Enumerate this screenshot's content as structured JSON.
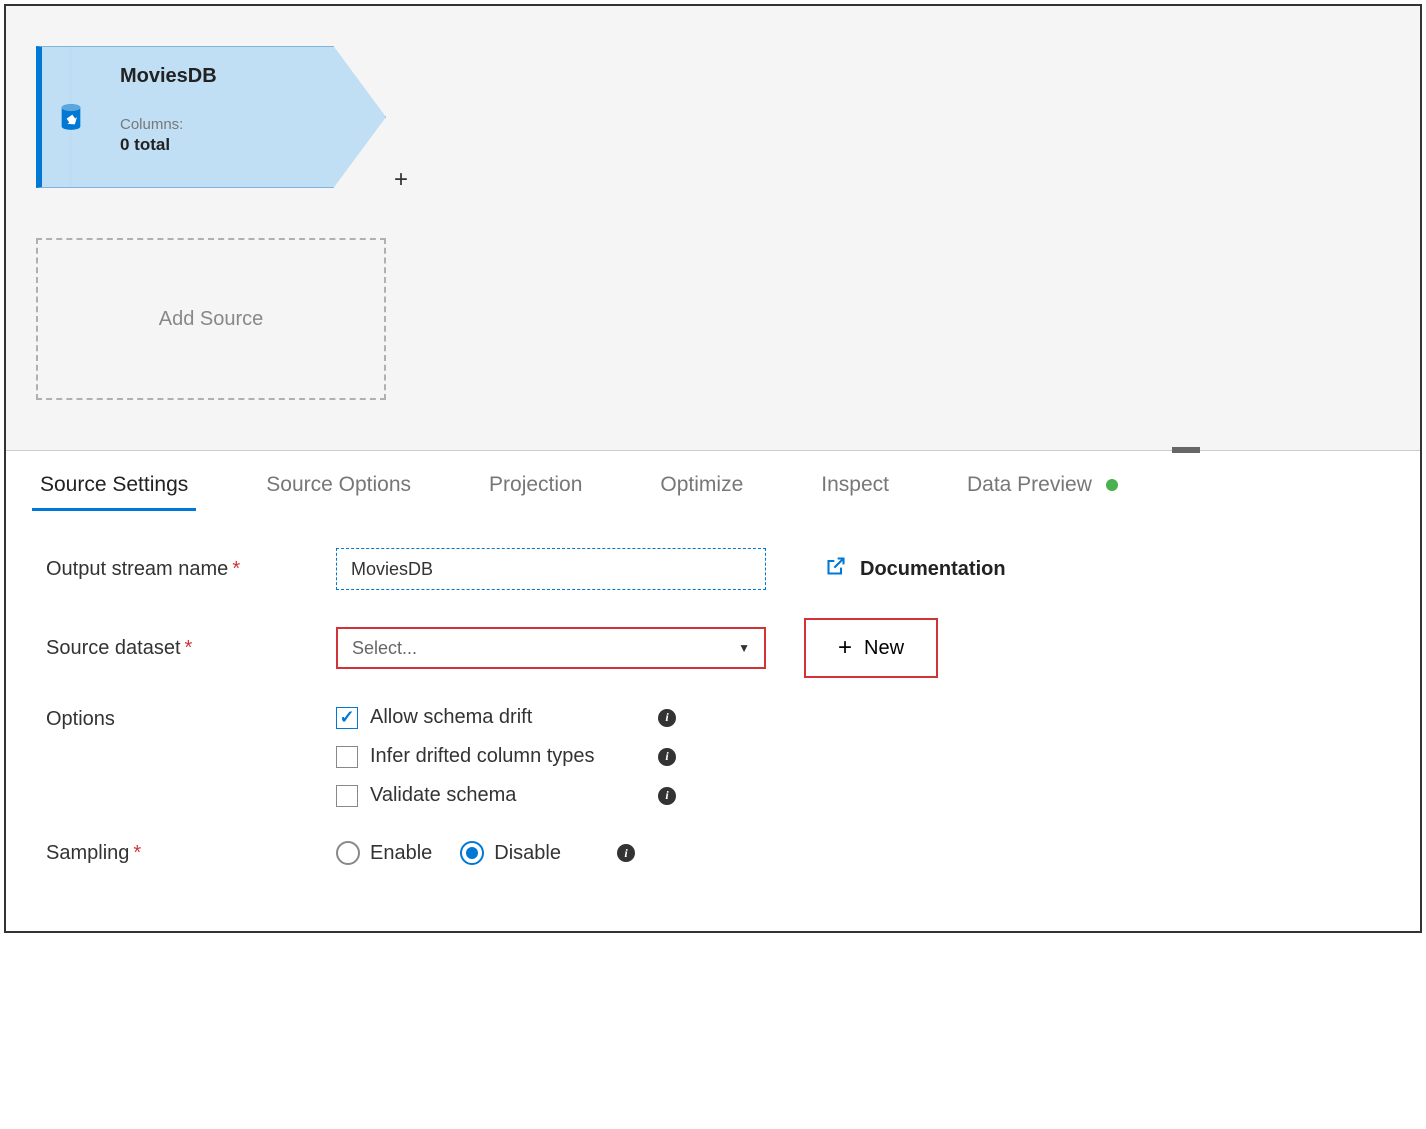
{
  "canvas": {
    "source_node": {
      "title": "MoviesDB",
      "columns_label": "Columns:",
      "columns_total": "0 total"
    },
    "add_source_label": "Add Source"
  },
  "tabs": [
    {
      "label": "Source Settings",
      "active": true
    },
    {
      "label": "Source Options"
    },
    {
      "label": "Projection"
    },
    {
      "label": "Optimize"
    },
    {
      "label": "Inspect"
    },
    {
      "label": "Data Preview",
      "status": "green"
    }
  ],
  "form": {
    "output_stream": {
      "label": "Output stream name",
      "value": "MoviesDB"
    },
    "source_dataset": {
      "label": "Source dataset",
      "placeholder": "Select..."
    },
    "options": {
      "label": "Options",
      "allow_schema_drift": {
        "label": "Allow schema drift",
        "checked": true
      },
      "infer_drifted": {
        "label": "Infer drifted column types",
        "checked": false
      },
      "validate_schema": {
        "label": "Validate schema",
        "checked": false
      }
    },
    "sampling": {
      "label": "Sampling",
      "enable": "Enable",
      "disable": "Disable"
    }
  },
  "side": {
    "documentation": "Documentation",
    "new_button": "New"
  }
}
